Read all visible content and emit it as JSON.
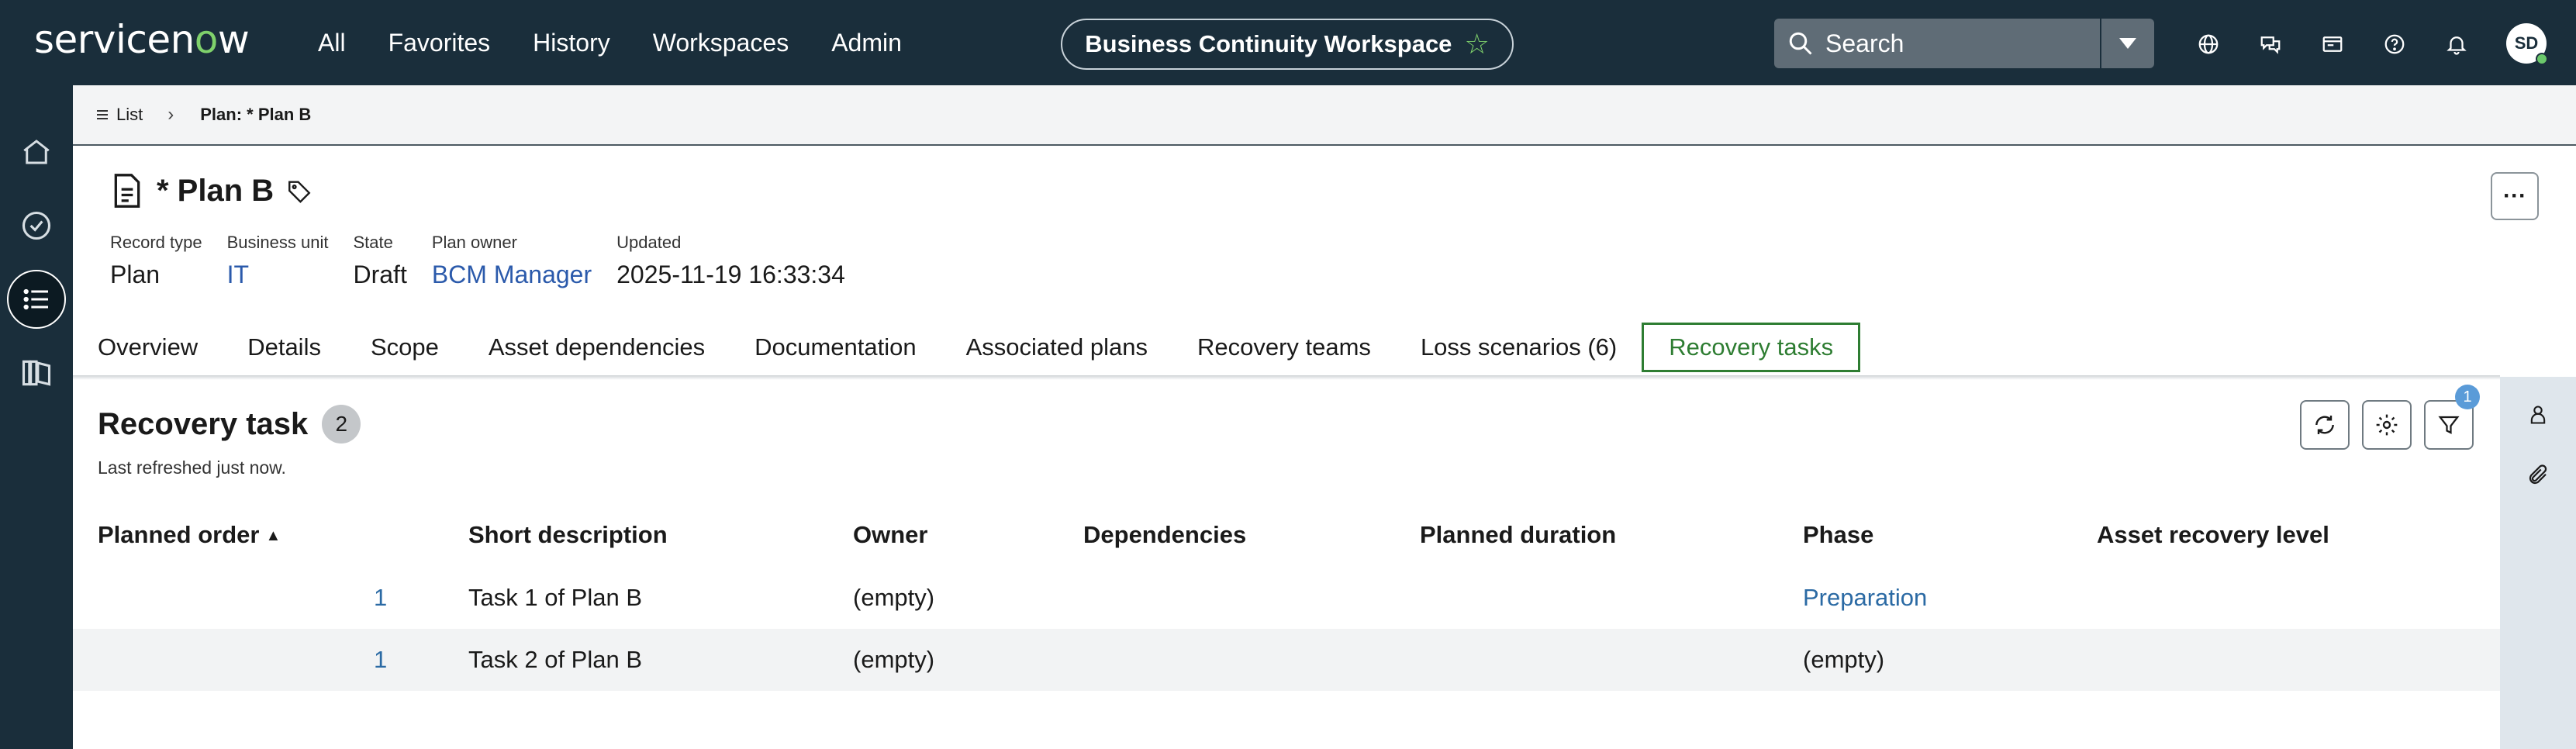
{
  "topnav": {
    "logo_prefix": "servicen",
    "logo_o": "o",
    "logo_suffix": "w",
    "links": [
      "All",
      "Favorites",
      "History",
      "Workspaces",
      "Admin"
    ],
    "workspace": "Business Continuity Workspace",
    "search_placeholder": "Search",
    "avatar_initials": "SD",
    "icons": [
      "globe-icon",
      "chat-icon",
      "workspace-card-icon",
      "help-icon",
      "bell-icon"
    ]
  },
  "leftrail": {
    "icons": [
      "home-icon",
      "check-circle-icon",
      "list-icon",
      "book-map-icon"
    ]
  },
  "breadcrumb": {
    "list_label": "List",
    "current": "Plan: * Plan B"
  },
  "record": {
    "title": "* Plan B",
    "fields": [
      {
        "label": "Record type",
        "value": "Plan",
        "link": false
      },
      {
        "label": "Business unit",
        "value": "IT",
        "link": true
      },
      {
        "label": "State",
        "value": "Draft",
        "link": false
      },
      {
        "label": "Plan owner",
        "value": "BCM Manager",
        "link": true
      },
      {
        "label": "Updated",
        "value": "2025-11-19 16:33:34",
        "link": false
      }
    ]
  },
  "tabs": [
    "Overview",
    "Details",
    "Scope",
    "Asset dependencies",
    "Documentation",
    "Associated plans",
    "Recovery teams",
    "Loss scenarios (6)",
    "Recovery tasks"
  ],
  "selected_tab": "Recovery tasks",
  "list": {
    "title": "Recovery task",
    "count": "2",
    "refreshed": "Last refreshed just now.",
    "filter_count": "1",
    "columns": [
      "Planned order",
      "Short description",
      "Owner",
      "Dependencies",
      "Planned duration",
      "Phase",
      "Asset recovery level"
    ],
    "rows": [
      {
        "order": "1",
        "desc": "Task 1 of Plan B",
        "owner": "(empty)",
        "deps": "",
        "duration": "",
        "phase": "Preparation",
        "phase_link": true,
        "level": ""
      },
      {
        "order": "1",
        "desc": "Task 2 of Plan B",
        "owner": "(empty)",
        "deps": "",
        "duration": "",
        "phase": "(empty)",
        "phase_link": false,
        "level": ""
      }
    ]
  },
  "colors": {
    "nav_bg": "#1a2e3b",
    "accent_green": "#7fd16b",
    "tab_selected": "#2e7d32",
    "link_blue": "#2b5aab"
  }
}
